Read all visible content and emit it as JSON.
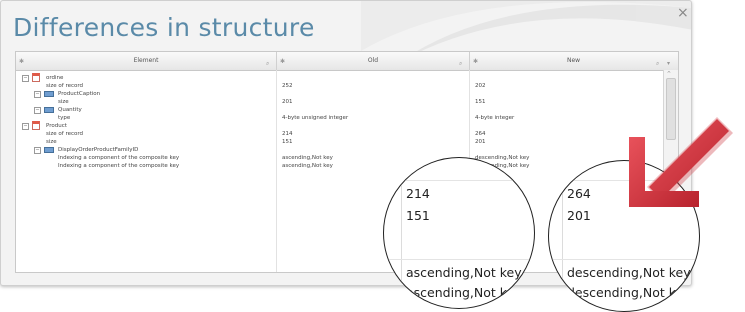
{
  "dialog": {
    "title": "Differences in structure",
    "close_label": "×"
  },
  "columns": {
    "element": "Element",
    "old": "Old",
    "new": "New"
  },
  "rows": [
    {
      "level": 0,
      "toggle": "−",
      "icon": "file",
      "element": "ordine",
      "old": "",
      "new": ""
    },
    {
      "level": 1,
      "toggle": "",
      "icon": "",
      "element": "size of record",
      "old": "252",
      "new": "202"
    },
    {
      "level": 1,
      "toggle": "−",
      "icon": "struct",
      "element": "ProductCaption",
      "old": "",
      "new": ""
    },
    {
      "level": 2,
      "toggle": "",
      "icon": "",
      "element": "size",
      "old": "201",
      "new": "151"
    },
    {
      "level": 1,
      "toggle": "−",
      "icon": "struct",
      "element": "Quantity",
      "old": "",
      "new": ""
    },
    {
      "level": 2,
      "toggle": "",
      "icon": "",
      "element": "type",
      "old": "4-byte unsigned integer",
      "new": "4-byte integer"
    },
    {
      "level": 0,
      "toggle": "−",
      "icon": "file",
      "element": "Product",
      "old": "",
      "new": ""
    },
    {
      "level": 1,
      "toggle": "",
      "icon": "",
      "element": "size of record",
      "old": "214",
      "new": "264"
    },
    {
      "level": 1,
      "toggle": "",
      "icon": "",
      "element": "size",
      "old": "151",
      "new": "201"
    },
    {
      "level": 1,
      "toggle": "−",
      "icon": "struct",
      "element": "DisplayOrderProductFamilyID",
      "old": "",
      "new": ""
    },
    {
      "level": 2,
      "toggle": "",
      "icon": "",
      "element": "Indexing a component of the composite key",
      "old": "ascending,Not key",
      "new": "descending,Not key"
    },
    {
      "level": 2,
      "toggle": "",
      "icon": "",
      "element": "Indexing a component of the composite key",
      "old": "ascending,Not key",
      "new": "descending,Not key"
    }
  ],
  "zoom_old": [
    "214",
    "151",
    "ascending,Not key",
    "ascending,Not key"
  ],
  "zoom_new": [
    "264",
    "201",
    "descending,Not key",
    "descending,Not key"
  ],
  "colors": {
    "title": "#5a8aa8",
    "arrow": "#d63a44",
    "table_icon": "#e05a48",
    "struct_icon": "#6f9dd0"
  }
}
